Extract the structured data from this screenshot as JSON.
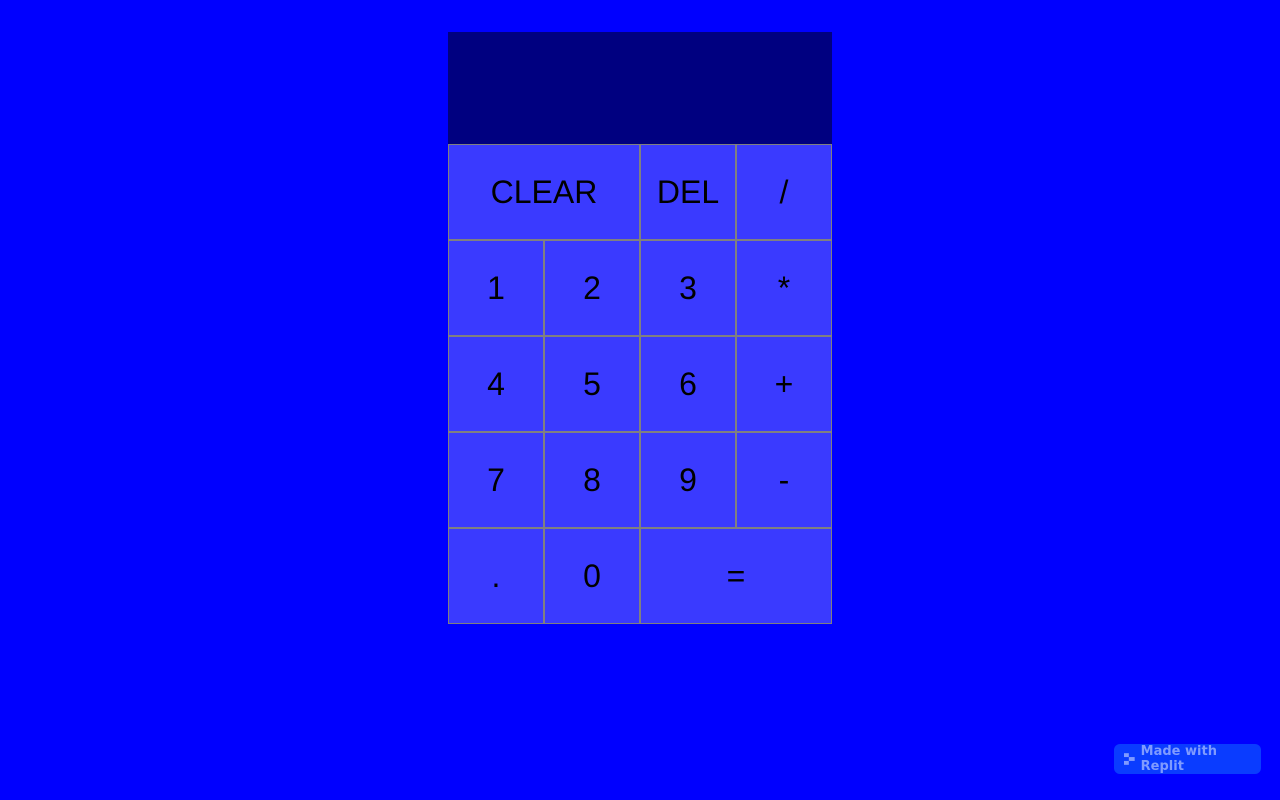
{
  "display": {
    "previous_operand": "",
    "current_operand": ""
  },
  "keys": {
    "clear": "CLEAR",
    "del": "DEL",
    "divide": "/",
    "one": "1",
    "two": "2",
    "three": "3",
    "multiply": "*",
    "four": "4",
    "five": "5",
    "six": "6",
    "plus": "+",
    "seven": "7",
    "eight": "8",
    "nine": "9",
    "minus": "-",
    "dot": ".",
    "zero": "0",
    "equals": "="
  },
  "badge": {
    "label": "Made with Replit",
    "icon": "replit-logo-icon"
  },
  "colors": {
    "page_background": "#0000ff",
    "display_background": "#000080",
    "key_background": "#3a3aff",
    "key_border": "#808080"
  }
}
